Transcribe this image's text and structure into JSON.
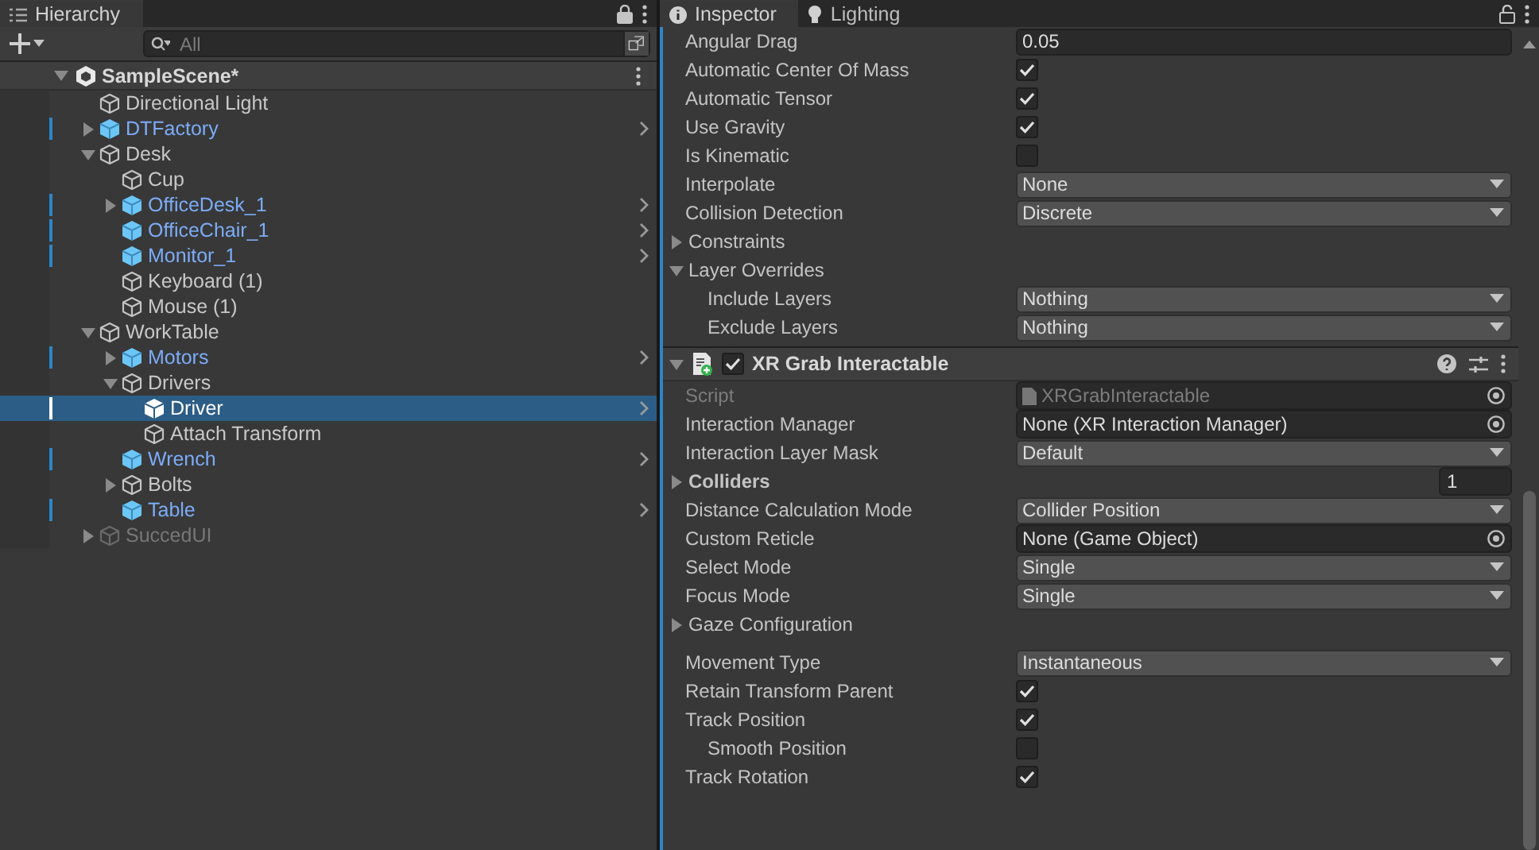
{
  "hierarchy": {
    "tab": {
      "label": "Hierarchy",
      "selected": true
    },
    "search": {
      "placeholder": "All"
    },
    "scene": {
      "name": "SampleScene*",
      "expanded": true
    },
    "items": [
      {
        "name": "Directional Light",
        "prefab": false,
        "selected": false,
        "disabled": false
      },
      {
        "name": "DTFactory",
        "prefab": true,
        "expanded": false,
        "selected": false,
        "disabled": false
      },
      {
        "name": "Desk",
        "prefab": false,
        "expanded": true,
        "selected": false,
        "disabled": false,
        "children": [
          {
            "name": "Cup",
            "prefab": false,
            "selected": false,
            "disabled": false
          },
          {
            "name": "OfficeDesk_1",
            "prefab": true,
            "expanded": false,
            "selected": false,
            "disabled": false
          },
          {
            "name": "OfficeChair_1",
            "prefab": true,
            "selected": false,
            "disabled": false
          },
          {
            "name": "Monitor_1",
            "prefab": true,
            "selected": false,
            "disabled": false
          },
          {
            "name": "Keyboard (1)",
            "prefab": false,
            "selected": false,
            "disabled": false
          },
          {
            "name": "Mouse (1)",
            "prefab": false,
            "selected": false,
            "disabled": false
          }
        ]
      },
      {
        "name": "WorkTable",
        "prefab": false,
        "expanded": true,
        "selected": false,
        "disabled": false,
        "children": [
          {
            "name": "Motors",
            "prefab": true,
            "expanded": false,
            "selected": false,
            "disabled": false
          },
          {
            "name": "Drivers",
            "prefab": false,
            "expanded": true,
            "selected": false,
            "disabled": false,
            "children": [
              {
                "name": "Driver",
                "prefab": true,
                "selected": true,
                "disabled": false
              },
              {
                "name": "Attach Transform",
                "prefab": false,
                "selected": false,
                "disabled": false
              }
            ]
          },
          {
            "name": "Wrench",
            "prefab": true,
            "selected": false,
            "disabled": false
          },
          {
            "name": "Bolts",
            "prefab": false,
            "expanded": false,
            "selected": false,
            "disabled": false
          },
          {
            "name": "Table",
            "prefab": true,
            "selected": false,
            "disabled": false
          }
        ]
      },
      {
        "name": "SuccedUI",
        "prefab": false,
        "expanded": false,
        "selected": false,
        "disabled": true
      }
    ]
  },
  "inspector": {
    "tabs": [
      {
        "label": "Inspector",
        "kind": "info",
        "selected": true
      },
      {
        "label": "Lighting",
        "kind": "bulb",
        "selected": false
      }
    ],
    "rows": [
      {
        "label": "Angular Drag",
        "kind": "text",
        "value": "0.05"
      },
      {
        "label": "Automatic Center Of Mass",
        "kind": "checkbox",
        "checked": true
      },
      {
        "label": "Automatic Tensor",
        "kind": "checkbox",
        "checked": true
      },
      {
        "label": "Use Gravity",
        "kind": "checkbox",
        "checked": true
      },
      {
        "label": "Is Kinematic",
        "kind": "checkbox",
        "checked": false
      },
      {
        "label": "Interpolate",
        "kind": "dropdown",
        "value": "None"
      },
      {
        "label": "Collision Detection",
        "kind": "dropdown",
        "value": "Discrete"
      },
      {
        "label": "Constraints",
        "kind": "foldout",
        "expanded": false
      },
      {
        "label": "Layer Overrides",
        "kind": "foldout",
        "expanded": true,
        "children": [
          {
            "label": "Include Layers",
            "kind": "dropdown",
            "value": "Nothing"
          },
          {
            "label": "Exclude Layers",
            "kind": "dropdown",
            "value": "Nothing"
          }
        ]
      }
    ],
    "component": {
      "title": "XR Grab Interactable",
      "enabled": true,
      "expanded": true,
      "rows": [
        {
          "label": "Script",
          "kind": "script",
          "value": "XRGrabInteractable",
          "disabled": true
        },
        {
          "label": "Interaction Manager",
          "kind": "object",
          "value": "None (XR Interaction Manager)"
        },
        {
          "label": "Interaction Layer Mask",
          "kind": "dropdown",
          "value": "Default"
        },
        {
          "label": "Colliders",
          "kind": "list",
          "value": "1",
          "expanded": false
        },
        {
          "label": "Distance Calculation Mode",
          "kind": "dropdown",
          "value": "Collider Position"
        },
        {
          "label": "Custom Reticle",
          "kind": "object",
          "value": "None (Game Object)"
        },
        {
          "label": "Select Mode",
          "kind": "dropdown",
          "value": "Single"
        },
        {
          "label": "Focus Mode",
          "kind": "dropdown",
          "value": "Single"
        },
        {
          "label": "Gaze Configuration",
          "kind": "foldout",
          "expanded": false
        },
        {
          "label": "Movement Type",
          "kind": "dropdown",
          "value": "Instantaneous",
          "spaced": true
        },
        {
          "label": "Retain Transform Parent",
          "kind": "checkbox",
          "checked": true
        },
        {
          "label": "Track Position",
          "kind": "checkbox",
          "checked": true,
          "children": [
            {
              "label": "Smooth Position",
              "kind": "checkbox",
              "checked": false
            }
          ]
        },
        {
          "label": "Track Rotation",
          "kind": "checkbox",
          "checked": true
        }
      ]
    }
  }
}
